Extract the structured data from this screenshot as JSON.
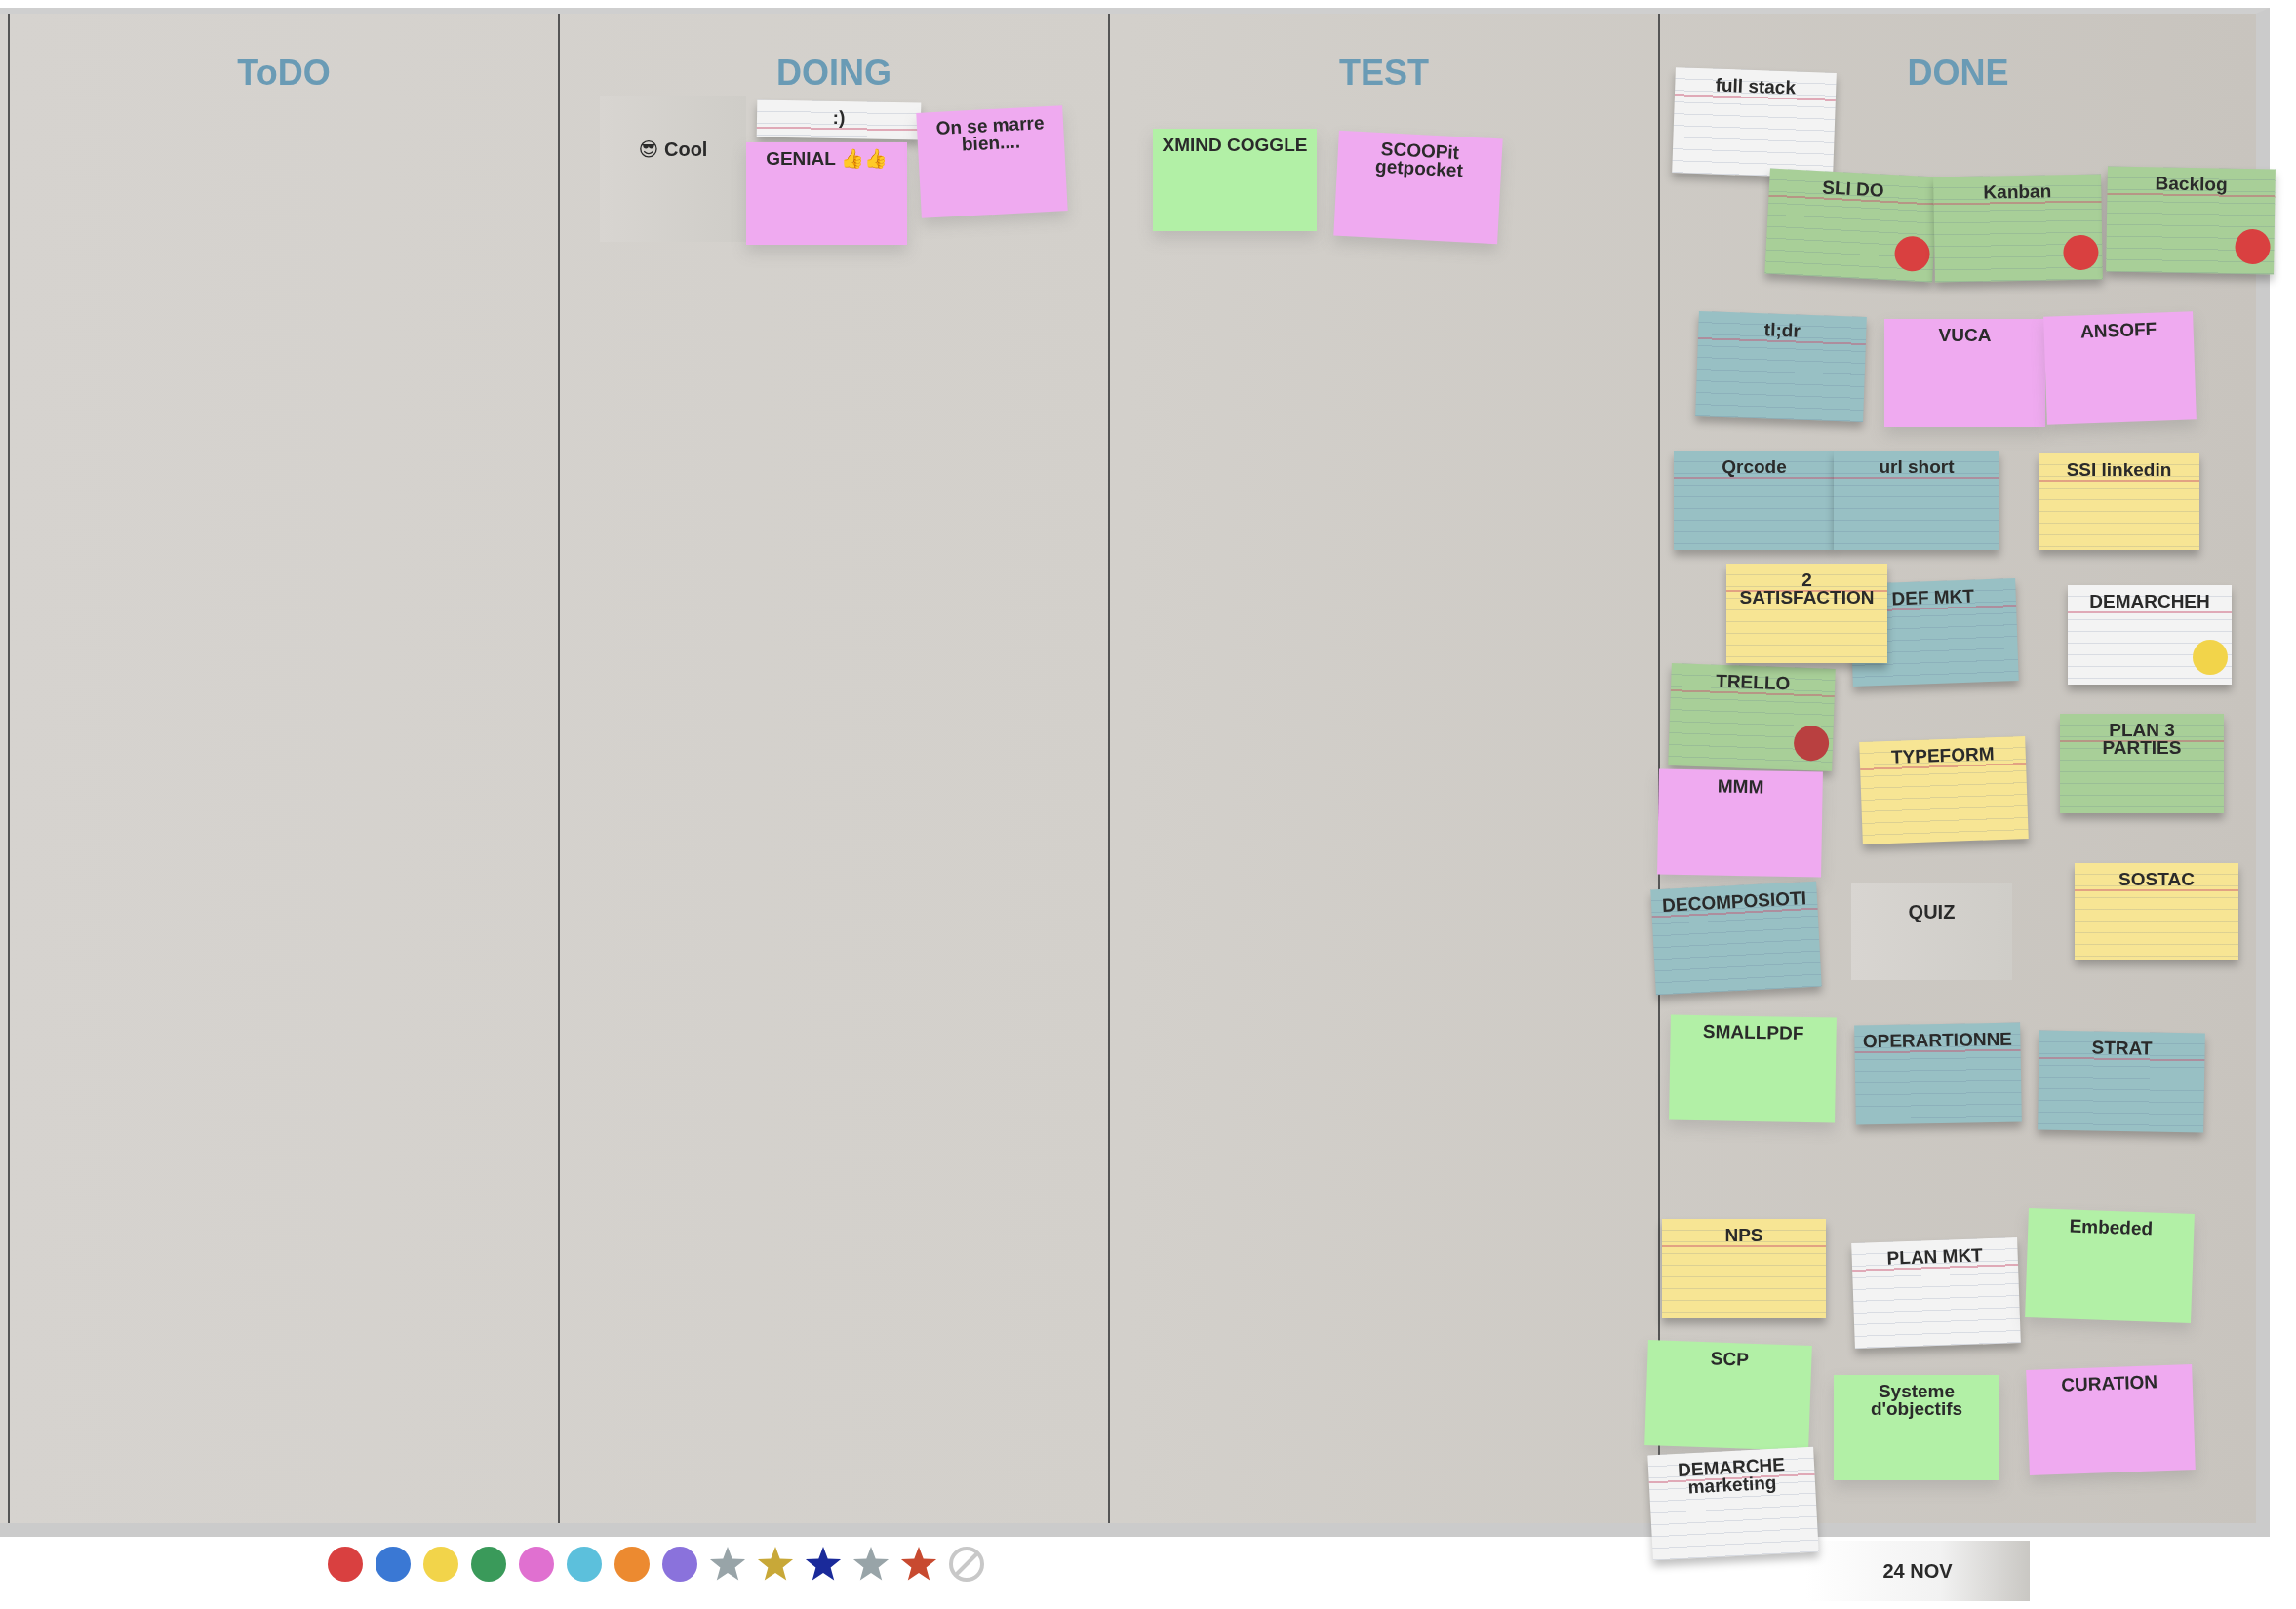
{
  "columns": [
    {
      "title": "ToDO"
    },
    {
      "title": "DOING",
      "cards": [
        {
          "text": "😎 Cool",
          "kind": "label",
          "color": "#cfcdc8"
        },
        {
          "text": ":)",
          "kind": "index",
          "color": "#f3f3f3"
        },
        {
          "text": "GENIAL 👍👍",
          "kind": "sticky",
          "color": "#efaaf0"
        },
        {
          "text": "On se marre\nbien....",
          "kind": "sticky",
          "color": "#efaaf0"
        }
      ]
    },
    {
      "title": "TEST",
      "cards": [
        {
          "text": "XMIND COGGLE",
          "kind": "sticky",
          "color": "#b2f0a6"
        },
        {
          "text": "SCOOPit\ngetpocket",
          "kind": "sticky",
          "color": "#efaaf0"
        }
      ]
    },
    {
      "title": "DONE",
      "cards": [
        {
          "text": "full stack",
          "kind": "index",
          "color": "#f3f3f3"
        },
        {
          "text": "SLI DO",
          "kind": "index",
          "color": "#a8cf98",
          "dot": {
            "color": "#d94040"
          }
        },
        {
          "text": "Kanban",
          "kind": "index",
          "color": "#a8cf98",
          "dot": {
            "color": "#d94040"
          }
        },
        {
          "text": "Backlog",
          "kind": "index",
          "color": "#a8cf98",
          "dot": {
            "color": "#d94040"
          }
        },
        {
          "text": "tl;dr",
          "kind": "index",
          "color": "#98c0c4"
        },
        {
          "text": "VUCA",
          "kind": "sticky",
          "color": "#efaaf0"
        },
        {
          "text": "ANSOFF",
          "kind": "sticky",
          "color": "#efaaf0"
        },
        {
          "text": "Qrcode",
          "kind": "index",
          "color": "#98c0c4"
        },
        {
          "text": "url short",
          "kind": "index",
          "color": "#98c0c4"
        },
        {
          "text": "SSI linkedin",
          "kind": "index",
          "color": "#f7e594"
        },
        {
          "text": "2\nSATISFACTION",
          "kind": "index",
          "color": "#f7e594"
        },
        {
          "text": "DEF MKT",
          "kind": "index",
          "color": "#98c0c4"
        },
        {
          "text": "DEMARCHEH",
          "kind": "index",
          "color": "#f3f3f3",
          "dot": {
            "color": "#f2d44a"
          }
        },
        {
          "text": "TRELLO",
          "kind": "index",
          "color": "#a8cf98",
          "dot": {
            "color": "#b94040"
          }
        },
        {
          "text": "TYPEFORM",
          "kind": "index",
          "color": "#f7e594"
        },
        {
          "text": "PLAN 3\nPARTIES",
          "kind": "index",
          "color": "#a8cf98"
        },
        {
          "text": "MMM",
          "kind": "sticky",
          "color": "#efaaf0"
        },
        {
          "text": "DECOMPOSIOTI",
          "kind": "index",
          "color": "#98c0c4"
        },
        {
          "text": "QUIZ",
          "kind": "label",
          "color": "#cfcdc8"
        },
        {
          "text": "SOSTAC",
          "kind": "index",
          "color": "#f7e594"
        },
        {
          "text": "SMALLPDF",
          "kind": "sticky",
          "color": "#b2f0a6"
        },
        {
          "text": "OPERARTIONNE",
          "kind": "index",
          "color": "#98c0c4"
        },
        {
          "text": "STRAT",
          "kind": "index",
          "color": "#98c0c4"
        },
        {
          "text": "NPS",
          "kind": "index",
          "color": "#f7e594"
        },
        {
          "text": "PLAN MKT",
          "kind": "index",
          "color": "#f3f3f3"
        },
        {
          "text": "Embeded",
          "kind": "sticky",
          "color": "#b2f0a6"
        },
        {
          "text": "SCP",
          "kind": "sticky",
          "color": "#b2f0a6"
        },
        {
          "text": "Systeme\nd'objectifs",
          "kind": "sticky",
          "color": "#b2f0a6"
        },
        {
          "text": "CURATION",
          "kind": "sticky",
          "color": "#efaaf0"
        },
        {
          "text": "DEMARCHE\nmarketing",
          "kind": "index",
          "color": "#f3f3f3"
        }
      ]
    }
  ],
  "palette": [
    {
      "kind": "dot",
      "color": "#d94040"
    },
    {
      "kind": "dot",
      "color": "#3a78d4"
    },
    {
      "kind": "dot",
      "color": "#f2d44a"
    },
    {
      "kind": "dot",
      "color": "#3a9a5a"
    },
    {
      "kind": "dot",
      "color": "#e070d0"
    },
    {
      "kind": "dot",
      "color": "#5cc0dc"
    },
    {
      "kind": "dot",
      "color": "#ec8a30"
    },
    {
      "kind": "dot",
      "color": "#8a72dc"
    },
    {
      "kind": "star",
      "color": "#98a4a8"
    },
    {
      "kind": "star",
      "color": "#c8a838"
    },
    {
      "kind": "star",
      "color": "#1a2a9a"
    },
    {
      "kind": "star",
      "color": "#98a4a8"
    },
    {
      "kind": "star",
      "color": "#c84a30"
    },
    {
      "kind": "none",
      "color": "#c8c8c8"
    }
  ],
  "date": "24 NOV"
}
